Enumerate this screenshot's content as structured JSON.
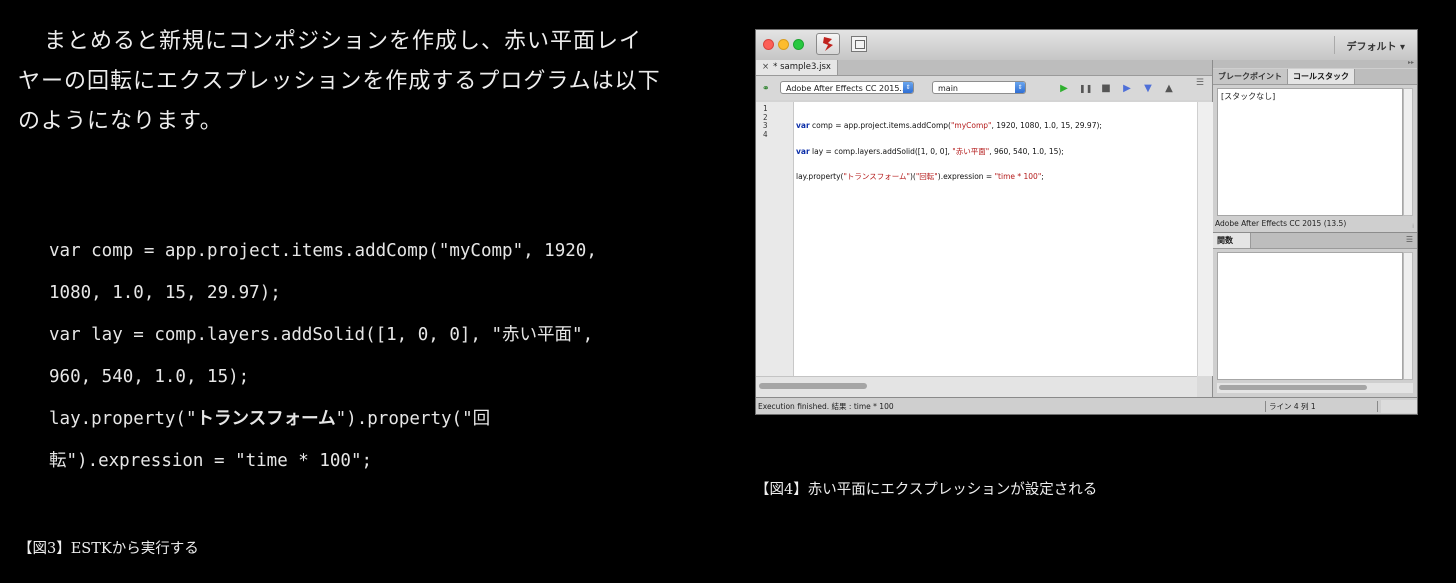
{
  "article": {
    "intro_line1": "まとめると新規にコンポジションを作成し、赤い平面レイ",
    "intro_line2": "ヤーの回転にエクスプレッションを作成するプログラムは以下",
    "intro_line3": "のようになります。",
    "code": {
      "line1": "var comp = app.project.items.addComp(\"myComp\", 1920,",
      "line2": "1080, 1.0, 15, 29.97);",
      "line3_prefix": "var lay = comp.layers.addSolid([1, 0, 0], \"",
      "line3_jp": "赤い平面",
      "line3_suffix": "\",",
      "line4": "960, 540, 1.0, 15);",
      "line5_prefix": "lay.property(\"",
      "line5_jp": "トランスフォーム",
      "line5_mid": "\").property(\"",
      "line5_jp2": "回",
      "line6_jp": "転",
      "line6_suffix": "\").expression = \"time * 100\";"
    },
    "caption_fig3": "【図3】ESTKから実行する",
    "caption_fig4": "【図4】赤い平面にエクスプレッションが設定される"
  },
  "estk": {
    "workspace_label": "デフォルト ▾",
    "doc_tab": {
      "close_glyph": "×",
      "label": "* sample3.jsx"
    },
    "target_app": "Adobe After Effects CC 2015...",
    "engine": "main",
    "select_arrows": "⇕",
    "controls": {
      "run": "▶",
      "pause": "❚❚",
      "stop": "■",
      "step_into": "▶",
      "step_over": "▼",
      "step_out": "▲"
    },
    "panel_menu_glyph": "☰",
    "line_numbers": [
      "1",
      "2",
      "3",
      "4"
    ],
    "code_lines": [
      {
        "kw": "var",
        "a": " comp = app.project.items.addComp(",
        "s1": "\"myComp\"",
        "b": ", 1920, 1080, 1.0, 15, 29.97);"
      },
      {
        "kw": "var",
        "a": " lay = comp.layers.addSolid([1, 0, 0], ",
        "s1": "\"赤い平面\"",
        "b": ", 960, 540, 1.0, 15);"
      },
      {
        "kw": "",
        "a": "lay.property(",
        "s1": "\"トランスフォーム\"",
        "b": ")(",
        "s2": "\"回転\"",
        "c": ").expression = ",
        "s3": "\"time * 100\"",
        "d": ";"
      }
    ],
    "right_panel": {
      "tab_breakpoints": "ブレークポイント",
      "tab_callstack": "コールスタック",
      "callstack_empty": "[スタックなし]",
      "engine_status": "Adobe After Effects CC 2015 (13.5)",
      "tab_functions": "関数",
      "strip_arrows": "▸▸",
      "grip_glyph": "⁞"
    },
    "status": {
      "message": "Execution finished. 結果 : time * 100",
      "position": "ライン 4   列 1"
    },
    "colors": {
      "keyword": "#0b2ea8",
      "string": "#b41b1b",
      "run_green": "#2fb02f"
    }
  }
}
